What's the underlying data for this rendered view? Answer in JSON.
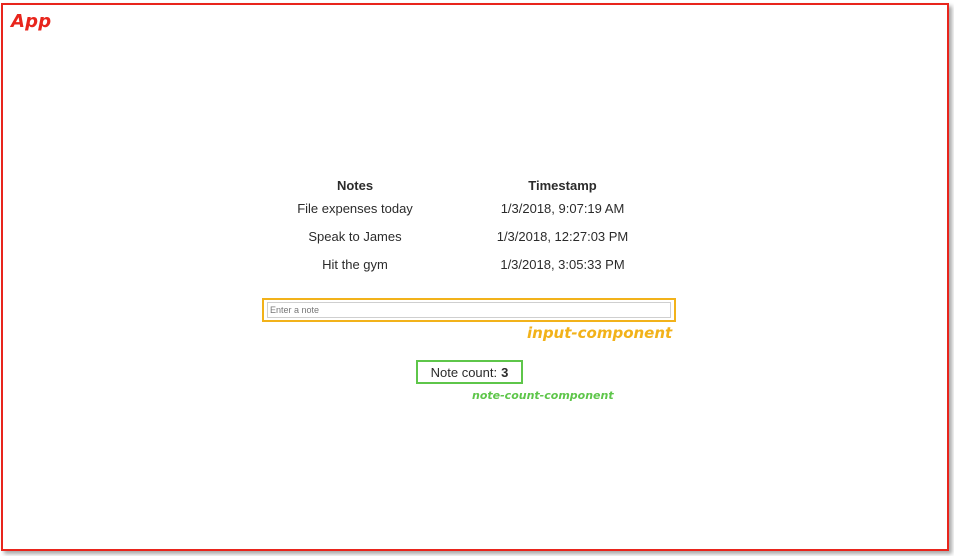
{
  "app": {
    "label": "App",
    "frame_color": "#e8251c"
  },
  "table": {
    "headers": {
      "notes": "Notes",
      "timestamp": "Timestamp"
    },
    "rows": [
      {
        "note": "File expenses today",
        "timestamp": "1/3/2018, 9:07:19 AM"
      },
      {
        "note": "Speak to James",
        "timestamp": "1/3/2018, 12:27:03 PM"
      },
      {
        "note": "Hit the gym",
        "timestamp": "1/3/2018, 3:05:33 PM"
      }
    ]
  },
  "input_component": {
    "label": "input-component",
    "placeholder": "Enter a note",
    "value": "",
    "outline_color": "#f2b21a"
  },
  "note_count_component": {
    "label": "note-count-component",
    "text": "Note count:",
    "count": "3",
    "outline_color": "#5ec64a"
  }
}
